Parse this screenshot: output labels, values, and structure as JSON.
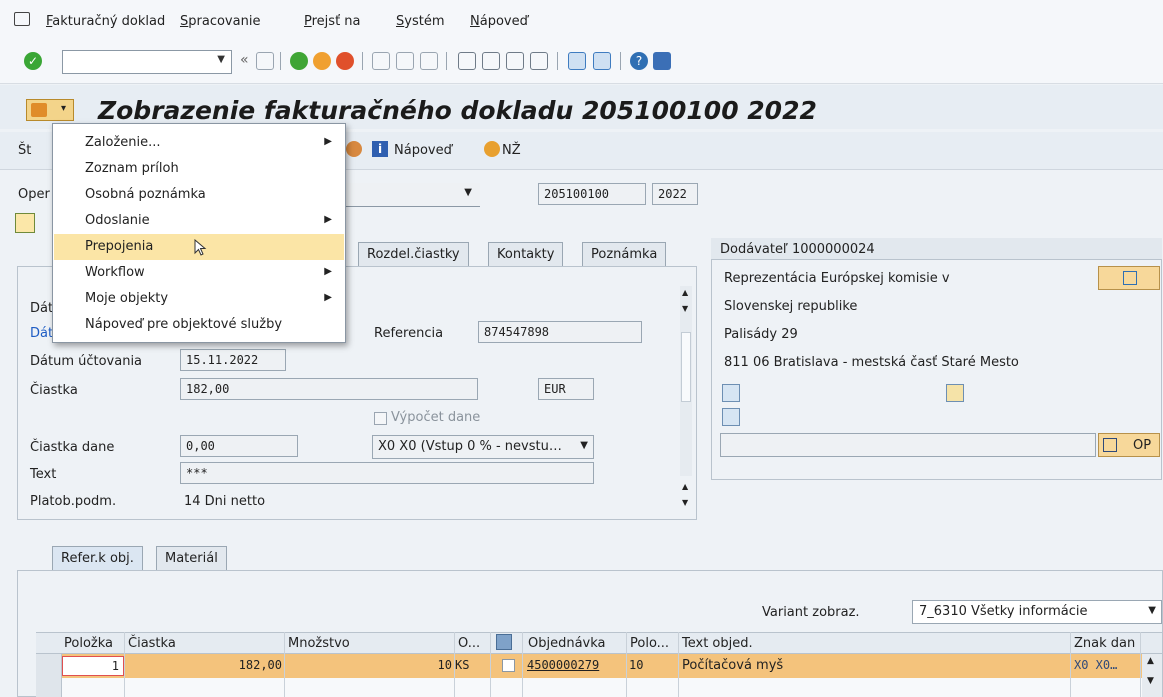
{
  "menubar": {
    "items": [
      "Fakturačný doklad",
      "Spracovanie",
      "Prejsť na",
      "Systém",
      "Nápoveď"
    ]
  },
  "toolbar": {
    "command_value": ""
  },
  "title": "Zobrazenie fakturačného dokladu 205100100 2022",
  "app_toolbar": {
    "first_label": "Št",
    "help_label": "Nápoveď",
    "nz_label": "NŽ"
  },
  "header": {
    "oper_label": "Oper",
    "doc_number": "205100100",
    "year": "2022"
  },
  "popup_menu": {
    "items": [
      {
        "label": "Založenie...",
        "submenu": true
      },
      {
        "label": "Zoznam príloh",
        "submenu": false
      },
      {
        "label": "Osobná poznámka",
        "submenu": false
      },
      {
        "label": "Odoslanie",
        "submenu": true
      },
      {
        "label": "Prepojenia",
        "submenu": false,
        "highlighted": true
      },
      {
        "label": "Workflow",
        "submenu": true
      },
      {
        "label": "Moje objekty",
        "submenu": true
      },
      {
        "label": "Nápoveď pre objektové služby",
        "submenu": false
      }
    ]
  },
  "tabs": {
    "rozdel": "Rozdel.čiastky",
    "kontakty": "Kontakty",
    "poznamka": "Poznámka"
  },
  "form": {
    "dat_label_1": "Dát",
    "dat_label_2": "Dát",
    "referencia_label": "Referencia",
    "referencia_value": "874547898",
    "datum_uctovania_label": "Dátum účtovania",
    "datum_uctovania_value": "15.11.2022",
    "ciastka_label": "Čiastka",
    "ciastka_value": "182,00",
    "currency": "EUR",
    "vypocet_dane_label": "Výpočet dane",
    "ciastka_dane_label": "Čiastka dane",
    "ciastka_dane_value": "0,00",
    "tax_code": "X0 X0 (Vstup 0 % - nevstu…",
    "text_label": "Text",
    "text_value": "***",
    "platob_label": "Platob.podm.",
    "platob_value": "14 Dni netto"
  },
  "vendor": {
    "header": "Dodávateľ 1000000024",
    "line1": "Reprezentácia Európskej komisie v",
    "line2": "Slovenskej republike",
    "line3": "Palisády 29",
    "line4": "811 06 Bratislava - mestská časť Staré Mesto",
    "op_label": "OP"
  },
  "bottom_tabs": {
    "refer": "Refer.k obj.",
    "material": "Materiál"
  },
  "variant": {
    "label": "Variant zobraz.",
    "value": "7_6310 Všetky informácie"
  },
  "table": {
    "columns": [
      "Položka",
      "Čiastka",
      "Množstvo",
      "O...",
      "Objednávka",
      "Polo...",
      "Text objed.",
      "Znak dan"
    ],
    "rows": [
      {
        "polozka": "1",
        "ciastka": "182,00",
        "mnozstvo": "10",
        "unit": "KS",
        "objednavka": "4500000279",
        "polo": "10",
        "text": "Počítačová myš",
        "znak": "X0 X0…"
      }
    ]
  }
}
